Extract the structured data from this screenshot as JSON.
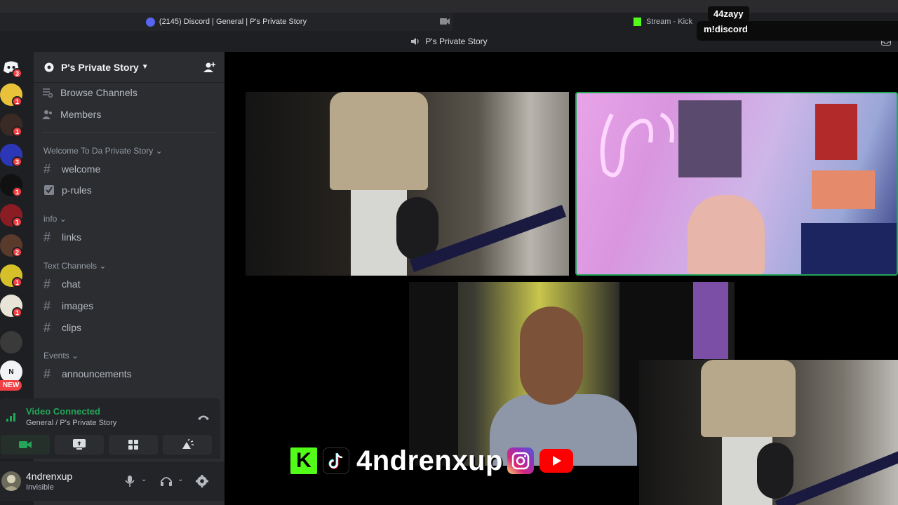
{
  "browser": {
    "active_tab": "(2145) Discord | General | P's Private Story",
    "inactive_tab": "Stream - Kick"
  },
  "stream_overlay": {
    "chat_user": "44zayy",
    "chat_message": "m!discord"
  },
  "window": {
    "title": "P's Private Story"
  },
  "servers": [
    {
      "badge": "3"
    },
    {
      "badge": "1"
    },
    {
      "badge": "1"
    },
    {
      "badge": "3"
    },
    {
      "badge": "1"
    },
    {
      "badge": "1"
    },
    {
      "badge": "2"
    },
    {
      "badge": "1"
    },
    {
      "badge": "1"
    },
    {
      "badge": ""
    },
    {
      "badge": ""
    }
  ],
  "server_new_label": "NEW",
  "server_n_label": "N",
  "sidebar": {
    "guild_name": "P's Private Story",
    "nav": [
      "Browse Channels",
      "Members"
    ],
    "categories": [
      {
        "name": "Welcome To Da Private Story",
        "channels": [
          "welcome",
          "p-rules"
        ]
      },
      {
        "name": "info",
        "channels": [
          "links"
        ]
      },
      {
        "name": "Text Channels",
        "channels": [
          "chat",
          "images",
          "clips"
        ]
      },
      {
        "name": "Events",
        "channels": [
          "announcements"
        ]
      }
    ]
  },
  "voice": {
    "status": "Video Connected",
    "location": "General / P's Private Story"
  },
  "user": {
    "name": "4ndrenxup",
    "status": "Invisible"
  },
  "stream_socials": {
    "handle": "4ndrenxup",
    "kick_letter": "K"
  },
  "colors": {
    "discord_blurple": "#5865f2",
    "online_green": "#23a55a",
    "badge_red": "#f23f43",
    "kick_green": "#53fc18",
    "youtube_red": "#ff0000"
  }
}
